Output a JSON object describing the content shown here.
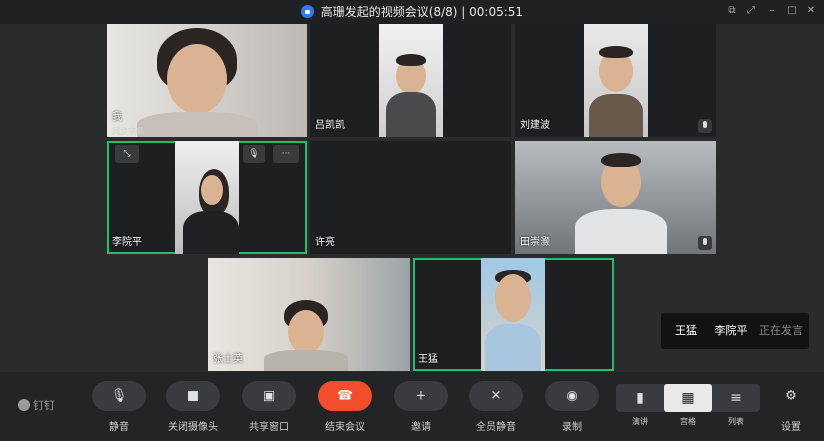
{
  "window": {
    "title": "高珊发起的视频会议(8/8)",
    "separator": "|",
    "timer": "00:05:51"
  },
  "participants": {
    "me": {
      "label": "我",
      "sublabel": "同步字幕"
    },
    "lv": {
      "label": "吕凯凯"
    },
    "liu": {
      "label": "刘建波"
    },
    "li": {
      "label": "李院平"
    },
    "xu": {
      "label": "许亮"
    },
    "tian": {
      "label": "田崇灏"
    },
    "zhang": {
      "label": "张士英"
    },
    "wang": {
      "label": "王猛"
    }
  },
  "speaking": {
    "names": [
      "王猛",
      "李院平"
    ],
    "status": "正在发言"
  },
  "toolbar": {
    "brand": "钉钉",
    "mute": "静音",
    "camera_off": "关闭摄像头",
    "share": "共享窗口",
    "end": "结束会议",
    "invite": "邀请",
    "mute_all": "全员静音",
    "record": "录制",
    "settings": "设置"
  },
  "layout": {
    "speaker": "演讲",
    "grid": "宫格",
    "list": "列表",
    "selected": "grid"
  },
  "colors": {
    "active_border": "#1fbf6a",
    "end_button": "#f24e2c",
    "lock": "#2b7cf6"
  }
}
